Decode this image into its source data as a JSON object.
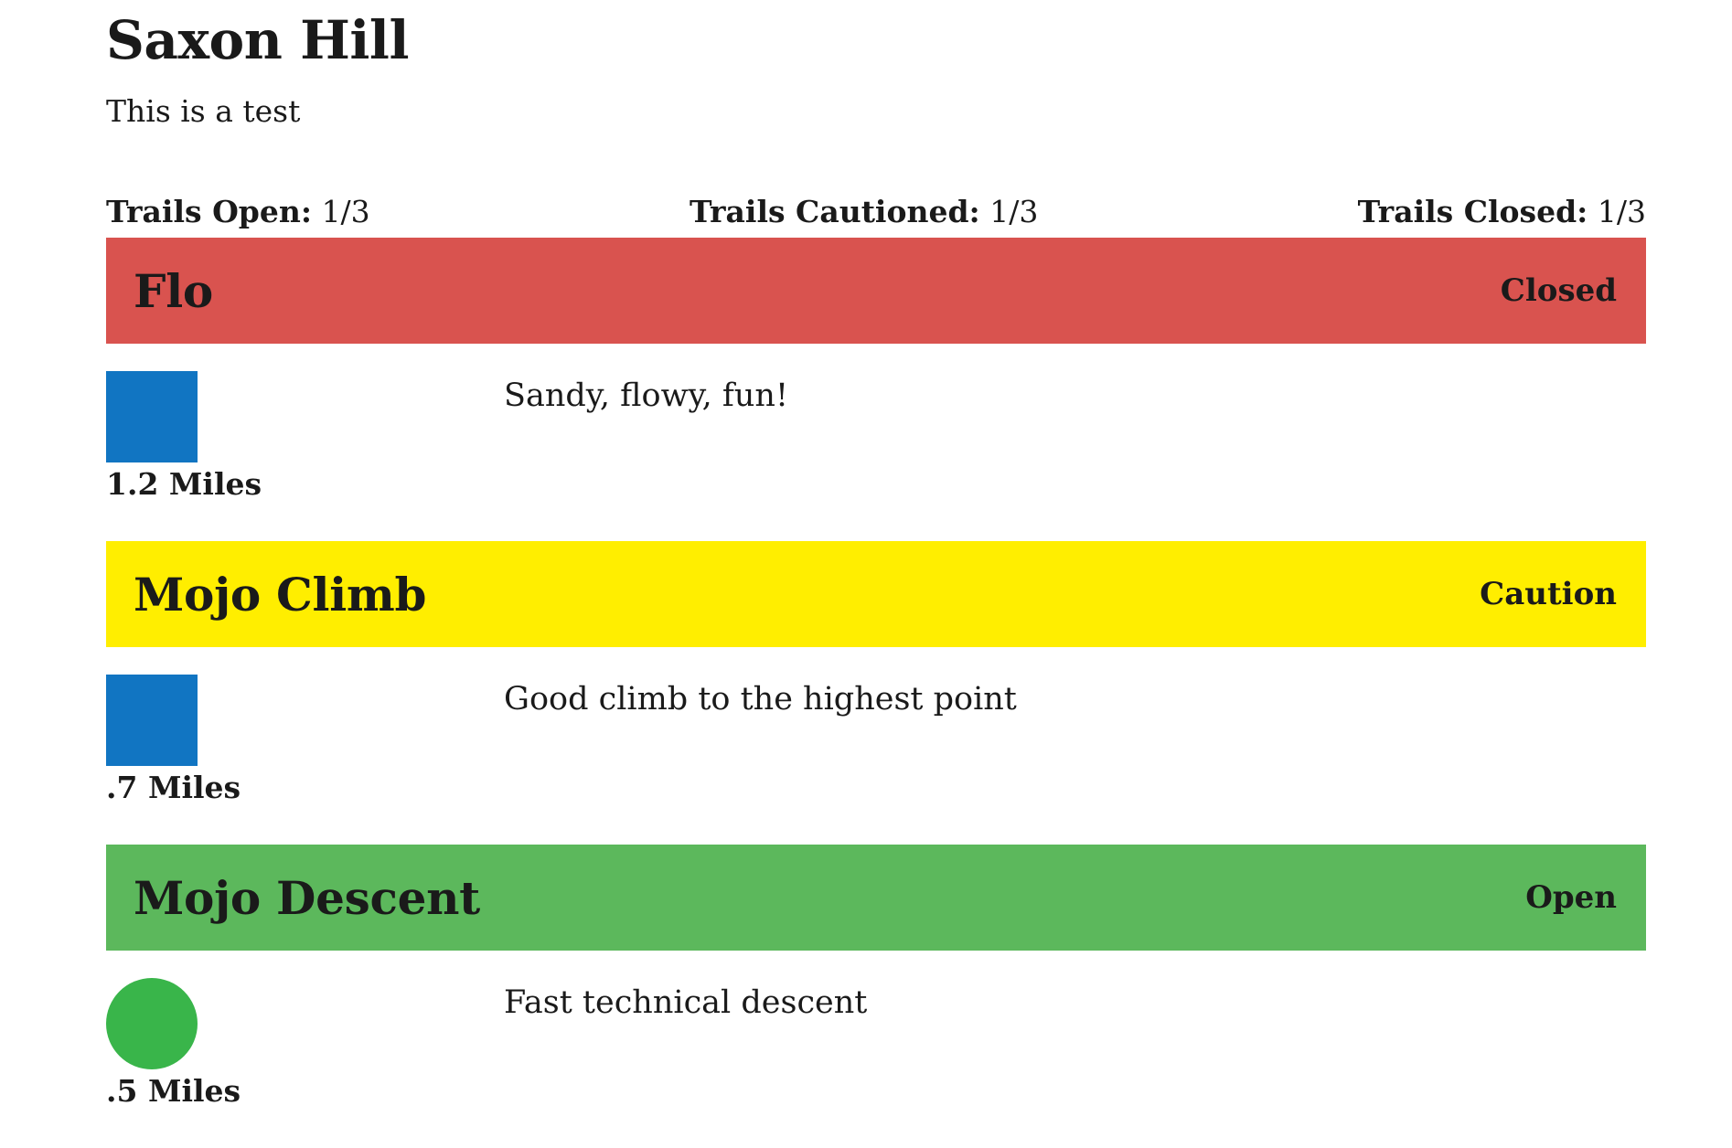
{
  "area": {
    "title": "Saxon Hill",
    "description": "This is a test"
  },
  "summary": {
    "open_label": "Trails Open:",
    "open_value": "1/3",
    "caution_label": "Trails Cautioned:",
    "caution_value": "1/3",
    "closed_label": "Trails Closed:",
    "closed_value": "1/3"
  },
  "trails": [
    {
      "name": "Flo",
      "status": "Closed",
      "status_color": "#d9534f",
      "difficulty_icon": "blue-square-icon",
      "distance": "1.2 Miles",
      "description": "Sandy, flowy, fun!"
    },
    {
      "name": "Mojo Climb",
      "status": "Caution",
      "status_color": "#ffee00",
      "difficulty_icon": "blue-square-icon",
      "distance": ".7 Miles",
      "description": "Good climb to the highest point"
    },
    {
      "name": "Mojo Descent",
      "status": "Open",
      "status_color": "#5cb85c",
      "difficulty_icon": "green-circle-icon",
      "distance": ".5 Miles",
      "description": "Fast technical descent"
    }
  ]
}
